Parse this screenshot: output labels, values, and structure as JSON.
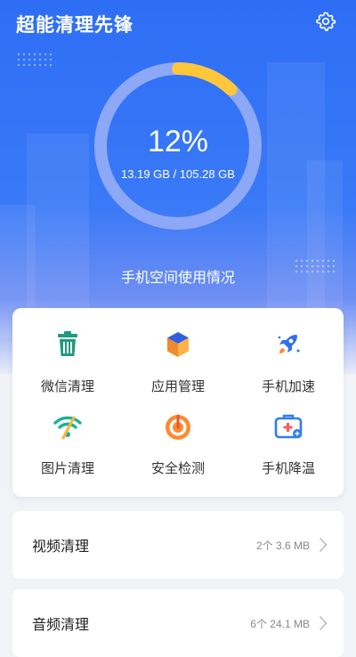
{
  "header": {
    "title": "超能清理先锋",
    "settings_icon": "gear-icon"
  },
  "storage": {
    "percent_text": "12%",
    "used_fraction": 0.12,
    "used": "13.19 GB",
    "total": "105.28 GB",
    "usage_text": "13.19 GB /  105.28 GB",
    "label": "手机空间使用情况"
  },
  "tools": [
    {
      "label": "微信清理",
      "icon": "trash-icon"
    },
    {
      "label": "应用管理",
      "icon": "cube-icon"
    },
    {
      "label": "手机加速",
      "icon": "rocket-icon"
    },
    {
      "label": "图片清理",
      "icon": "wifi-icon"
    },
    {
      "label": "安全检测",
      "icon": "target-icon"
    },
    {
      "label": "手机降温",
      "icon": "medkit-icon"
    }
  ],
  "list": [
    {
      "label": "视频清理",
      "info": "2个 3.6 MB"
    },
    {
      "label": "音频清理",
      "info": "6个 24.1 MB"
    }
  ],
  "colors": {
    "accent": "#2e6ef5",
    "ring_track": "#8da8f7",
    "ring_progress": "#ffc63a",
    "trash": "#1f9b7f",
    "rocket": "#2f6ff0",
    "wifi": "#16b692",
    "target": "#ff8a2e",
    "medkit": "#2f7df0"
  }
}
